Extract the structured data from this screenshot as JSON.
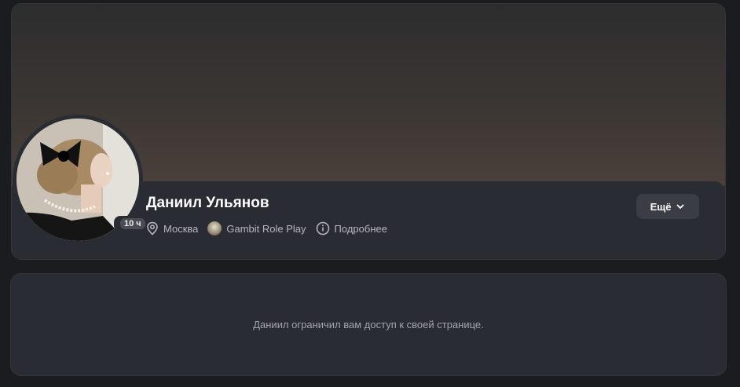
{
  "profile": {
    "name": "Даниил Ульянов",
    "last_seen_badge": "10 ч",
    "location": "Москва",
    "group": "Gambit Role Play",
    "details_label": "Подробнее",
    "more_button_label": "Ещё"
  },
  "restricted": {
    "message": "Даниил ограничил вам доступ к своей странице."
  },
  "icons": {
    "location": "location-pin-icon",
    "info": "info-circle-icon",
    "chevron": "chevron-down-icon"
  },
  "colors": {
    "background": "#1b1c1f",
    "card": "#2a2c33",
    "button": "#3b3d45"
  }
}
